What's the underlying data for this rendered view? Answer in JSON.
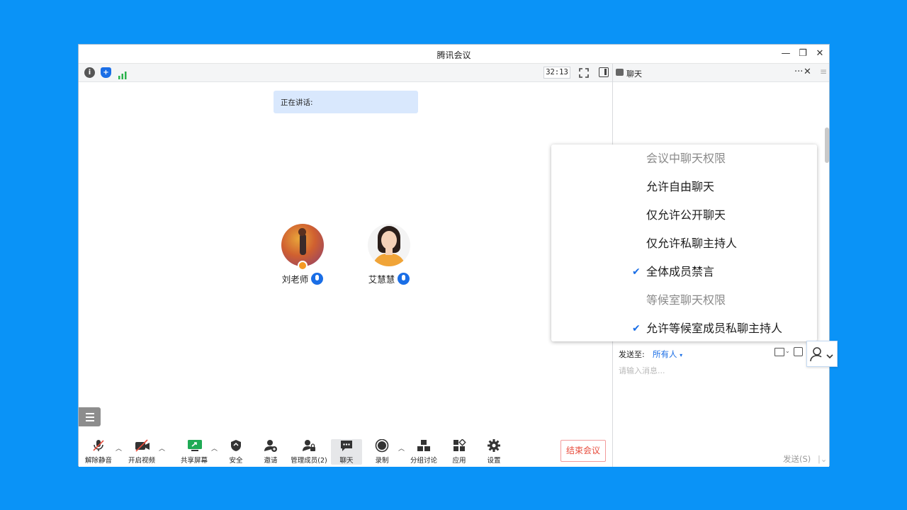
{
  "window": {
    "title": "腾讯会议"
  },
  "topbar": {
    "timer": "32:13"
  },
  "main": {
    "speaking_label": "正在讲话:",
    "participants": [
      {
        "name": "刘老师"
      },
      {
        "name": "艾慧慧"
      }
    ]
  },
  "toolbar": {
    "unmute": "解除静音",
    "start_video": "开启视频",
    "share_screen": "共享屏幕",
    "security": "安全",
    "invite": "邀请",
    "manage_members": "管理成员(2)",
    "chat": "聊天",
    "record": "录制",
    "breakout": "分组讨论",
    "apps": "应用",
    "settings": "设置",
    "end_meeting": "结束会议"
  },
  "chat": {
    "title": "聊天",
    "send_to_label": "发送至:",
    "send_to_value": "所有人",
    "placeholder": "请输入消息...",
    "send_button": "发送(S)"
  },
  "menu": {
    "items": [
      {
        "label": "会议中聊天权限",
        "header": true,
        "checked": false
      },
      {
        "label": "允许自由聊天",
        "header": false,
        "checked": false
      },
      {
        "label": "仅允许公开聊天",
        "header": false,
        "checked": false
      },
      {
        "label": "仅允许私聊主持人",
        "header": false,
        "checked": false
      },
      {
        "label": "全体成员禁言",
        "header": false,
        "checked": true
      },
      {
        "label": "等候室聊天权限",
        "header": true,
        "checked": false
      },
      {
        "label": "允许等候室成员私聊主持人",
        "header": false,
        "checked": true
      }
    ]
  },
  "colors": {
    "accent": "#1a6ee6",
    "background": "#0a93f7",
    "danger": "#e74c3c"
  }
}
